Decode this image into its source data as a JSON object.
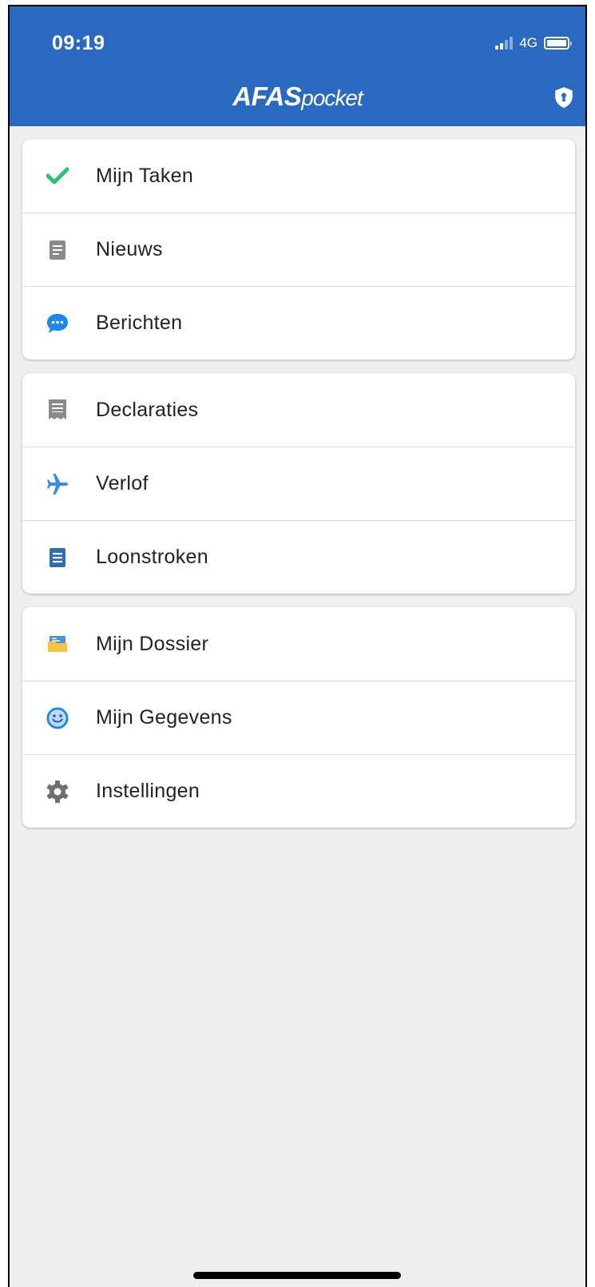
{
  "status_bar": {
    "time": "09:19",
    "network": "4G"
  },
  "header": {
    "brand": "AFAS",
    "product": "pocket",
    "icon": "shield-icon"
  },
  "colors": {
    "header_bg": "#2a69bf",
    "page_bg": "#efefef",
    "check_green": "#2fbf71",
    "chat_blue": "#1e88e5",
    "plane_blue": "#3a8fd9",
    "doc_blue": "#2d6fb0",
    "grey_icon": "#8a8a8a",
    "folder_yellow": "#f4c542"
  },
  "menu": {
    "group1": [
      {
        "label": "Mijn Taken",
        "icon": "check-icon"
      },
      {
        "label": "Nieuws",
        "icon": "document-icon"
      },
      {
        "label": "Berichten",
        "icon": "chat-bubble-icon"
      }
    ],
    "group2": [
      {
        "label": "Declaraties",
        "icon": "receipt-icon"
      },
      {
        "label": "Verlof",
        "icon": "airplane-icon"
      },
      {
        "label": "Loonstroken",
        "icon": "payslip-icon"
      }
    ],
    "group3": [
      {
        "label": "Mijn Dossier",
        "icon": "folder-icon"
      },
      {
        "label": "Mijn Gegevens",
        "icon": "smiley-icon"
      },
      {
        "label": "Instellingen",
        "icon": "gear-icon"
      }
    ]
  }
}
